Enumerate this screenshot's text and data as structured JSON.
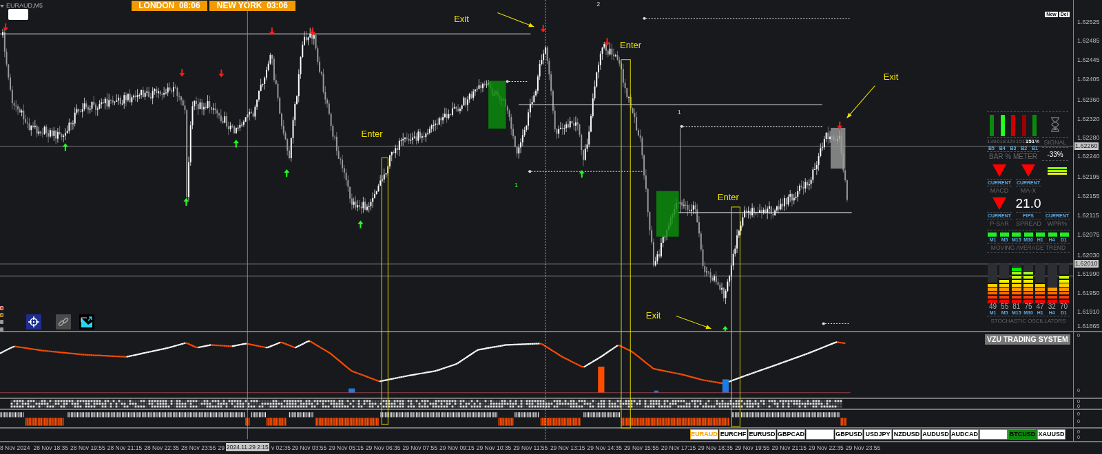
{
  "chart": {
    "symbol": "EURAUD,M5",
    "sessions": [
      "LONDON  08:06",
      "NEW YORK  03:06"
    ],
    "buttons": [
      "New",
      "Del"
    ],
    "annotations": [
      {
        "text": "Exit"
      },
      {
        "text": "Enter"
      },
      {
        "text": "Enter"
      },
      {
        "text": "Exit"
      },
      {
        "text": "Enter"
      },
      {
        "text": "Exit"
      }
    ],
    "markers": [
      "2",
      "1",
      "1"
    ]
  },
  "price_axis": {
    "ticks": [
      "1.62525",
      "1.62485",
      "1.62445",
      "1.62405",
      "1.62360",
      "1.62320",
      "1.62280",
      "1.62240",
      "1.62195",
      "1.62155",
      "1.62115",
      "1.62075",
      "1.62030",
      "1.61990",
      "1.61950",
      "1.61910",
      "1.61865"
    ],
    "marks": [
      "1.62260",
      "1.62010"
    ]
  },
  "dashboard": {
    "bar_meter": {
      "title": "BAR % METER",
      "unit": "%",
      "bars": [
        {
          "value": "139",
          "label": "B5",
          "color": "#0a8a0a",
          "current": false
        },
        {
          "value": "618",
          "label": "B4",
          "color": "#22ff22",
          "current": false
        },
        {
          "value": "329",
          "label": "B3",
          "color": "#cc0000",
          "current": false
        },
        {
          "value": "151",
          "label": "B2",
          "color": "#990000",
          "current": false
        },
        {
          "value": "151",
          "label": "B1",
          "color": "#0a8a0a",
          "current": true
        }
      ]
    },
    "signal": {
      "title": "SIGNAL",
      "value": "-33%"
    },
    "indicators": [
      {
        "kind": "down_arrow",
        "status": "CURRENT",
        "name": "MACD"
      },
      {
        "kind": "down_arrow",
        "status": "CURRENT",
        "name": "MA-X"
      },
      {
        "kind": "down_arrow",
        "status": "CURRENT",
        "name": "P-SAR"
      },
      {
        "kind": "reading",
        "value": "21.0",
        "status": "PIPS",
        "name": "SPREAD"
      },
      {
        "kind": "bars",
        "status": "CURRENT",
        "name": "WPR%"
      }
    ],
    "ma_trend": {
      "title": "MOVING AVERAGE TREND",
      "frames": [
        {
          "label": "M1",
          "up": true
        },
        {
          "label": "M5",
          "up": true
        },
        {
          "label": "M15",
          "up": true
        },
        {
          "label": "M30",
          "up": true
        },
        {
          "label": "H1",
          "up": true
        },
        {
          "label": "H4",
          "up": true
        },
        {
          "label": "D1",
          "up": true
        }
      ]
    },
    "stochastic": {
      "title": "STOCHASTIC OSCILLATORS",
      "frames": [
        {
          "label": "M1",
          "value": "49",
          "level": 0.5
        },
        {
          "label": "M5",
          "value": "55",
          "level": 0.6
        },
        {
          "label": "M15",
          "value": "81",
          "level": 0.9
        },
        {
          "label": "M30",
          "value": "75",
          "level": 0.8
        },
        {
          "label": "H1",
          "value": "47",
          "level": 0.5
        },
        {
          "label": "H4",
          "value": "32",
          "level": 0.4
        },
        {
          "label": "D1",
          "value": "70",
          "level": 0.7
        }
      ]
    }
  },
  "indicator_pane": {
    "title": "VZU TRADING SYSTEM"
  },
  "pane_scales": [
    "0",
    "0",
    "0",
    "0",
    "0",
    "0",
    "0",
    "0"
  ],
  "symbols": [
    {
      "label": "EURAUD",
      "selected": true,
      "highlighted": false
    },
    {
      "label": "EURCHF",
      "selected": false,
      "highlighted": false
    },
    {
      "label": "EURUSD",
      "selected": false,
      "highlighted": false
    },
    {
      "label": "GBPCAD",
      "selected": false,
      "highlighted": false
    },
    {
      "selected": false,
      "highlighted": false
    },
    {
      "label": "GBPUSD",
      "selected": false,
      "highlighted": false
    },
    {
      "label": "USDJPY",
      "selected": false,
      "highlighted": false
    },
    {
      "label": "NZDUSD",
      "selected": false,
      "highlighted": false
    },
    {
      "label": "AUDUSD",
      "selected": false,
      "highlighted": false
    },
    {
      "label": "AUDCAD",
      "selected": false,
      "highlighted": false
    },
    {
      "selected": false,
      "highlighted": false
    },
    {
      "label": "BTCUSD",
      "selected": false,
      "highlighted": true
    },
    {
      "label": "XAUUSD",
      "selected": false,
      "highlighted": false
    }
  ],
  "time_axis": {
    "labels": [
      "8 Nov 2024",
      "28 Nov 18:35",
      "28 Nov 19:55",
      "28 Nov 21:15",
      "28 Nov 22:35",
      "28 Nov 23:55",
      "29",
      "v 02:35",
      "29 Nov 03:55",
      "29 Nov 05:15",
      "29 Nov 06:35",
      "29 Nov 07:55",
      "29 Nov 09:15",
      "29 Nov 10:35",
      "29 Nov 11:55",
      "29 Nov 13:15",
      "29 Nov 14:35",
      "29 Nov 15:55",
      "29 Nov 17:15",
      "29 Nov 18:35",
      "29 Nov 19:55",
      "29 Nov 21:15",
      "29 Nov 22:35",
      "29 Nov 23:55"
    ],
    "cursor": "2024.11.29 2:15"
  }
}
